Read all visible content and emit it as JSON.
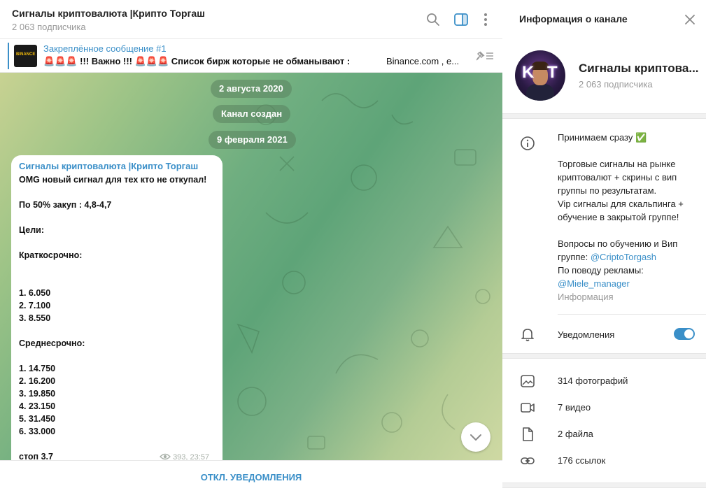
{
  "header": {
    "title": "Сигналы криптовалюта |Крипто Торгаш",
    "subscribers": "2 063 подписчика",
    "icons": [
      "search-icon",
      "sidebar-toggle-icon",
      "more-vertical-icon"
    ]
  },
  "pinned": {
    "thumb_text": "BINANCE",
    "title": "Закреплённое сообщение #1",
    "text": "🚨🚨🚨 !!! Важно !!! 🚨🚨🚨  Список бирж которые не обманывают :",
    "text_tail": "Binance.com , e..."
  },
  "feed": {
    "date_1": "2 августа 2020",
    "service": "Канал создан",
    "date_2": "9 февраля 2021"
  },
  "message": {
    "author": "Сигналы криптовалюта |Крипто Торгаш",
    "text": "OMG новый сигнал для тех кто не откупал!\n\nПо 50% закуп : 4,8-4,7\n\nЦели:\n\nКраткосрочно:\n\n\n1. 6.050\n2. 7.100\n3. 8.550\n\nСреднесрочно:\n\n1. 14.750\n2. 16.200\n3. 19.850\n4. 23.150\n5. 31.450\n6. 33.000\n\nстоп 3.7",
    "views": "393",
    "time": "23:57"
  },
  "footer": {
    "mute_label": "ОТКЛ. УВЕДОМЛЕНИЯ"
  },
  "info": {
    "title": "Информация о канале",
    "channel_name": "Сигналы криптова...",
    "subscribers": "2 063 подписчика",
    "avatar_letters": [
      "K",
      "T"
    ],
    "description": {
      "line_1": "Принимаем сразу ✅",
      "line_2": "Торговые сигналы на рынке криптовалют + скрины с вип группы по результатам.\nVip сигналы для скальпинга + обучение в закрытой группе!",
      "line_3": "Вопросы по обучению и Вип группе: ",
      "link_1": "@CriptoTorgash",
      "line_4": "По поводу рекламы:",
      "link_2": "@Miele_manager",
      "label": "Информация"
    },
    "notifications_label": "Уведомления",
    "notifications_on": true,
    "media": {
      "photos": "314 фотографий",
      "videos": "7 видео",
      "files": "2 файла",
      "links": "176 ссылок"
    }
  },
  "colors": {
    "accent": "#3a8fc8",
    "muted_text": "#999999"
  }
}
